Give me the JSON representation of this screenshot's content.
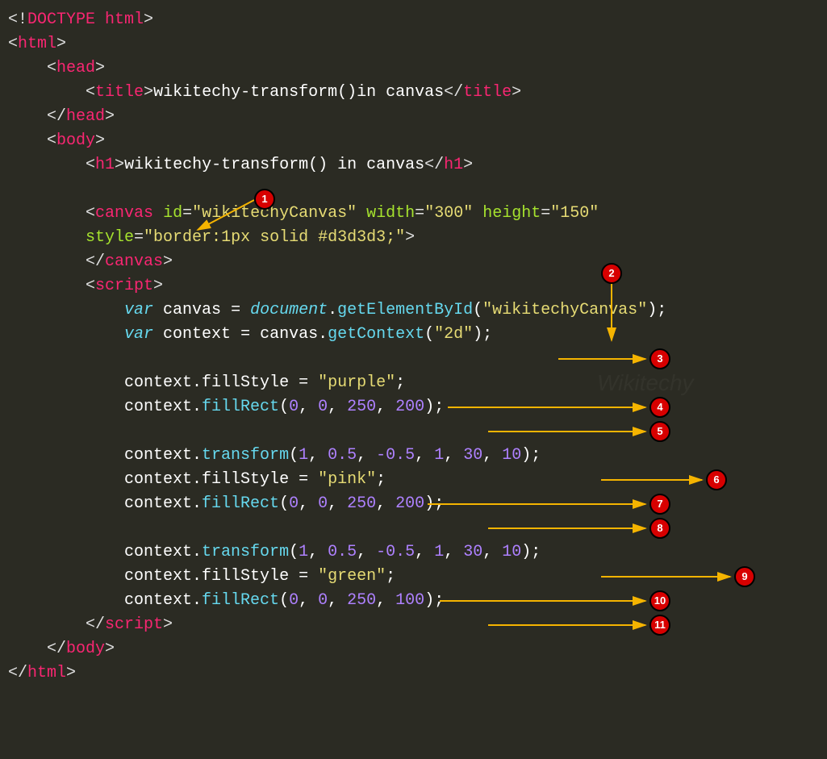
{
  "code": {
    "doctype": {
      "open": "<!",
      "name": "DOCTYPE html",
      "close": ">"
    },
    "html_open": "html",
    "head_open": "head",
    "title_tag": "title",
    "title_text": "wikitechy-transform()in canvas",
    "head_close": "head",
    "body_open": "body",
    "h1_tag": "h1",
    "h1_text": "wikitechy-transform() in canvas",
    "canvas_tag": "canvas",
    "canvas_attrs": {
      "id_name": "id",
      "id_val": "\"wikitechyCanvas\"",
      "width_name": "width",
      "width_val": "\"300\"",
      "height_name": "height",
      "height_val": "\"150\"",
      "style_name": "style",
      "style_val": "\"border:1px solid #d3d3d3;\""
    },
    "script_tag": "script",
    "lines": {
      "l1_var": "var",
      "l1_a": " canvas = ",
      "l1_doc": "document",
      "l1_b": ".",
      "l1_fn": "getElementById",
      "l1_c": "(",
      "l1_str": "\"wikitechyCanvas\"",
      "l1_d": ");",
      "l2_var": "var",
      "l2_a": " context = canvas.",
      "l2_fn": "getContext",
      "l2_c": "(",
      "l2_str": "\"2d\"",
      "l2_d": ");",
      "l3": "context.fillStyle = ",
      "l3_str": "\"purple\"",
      "l3_end": ";",
      "l4_a": "context.",
      "l4_fn": "fillRect",
      "l4_b": "(",
      "l4_n1": "0",
      "l4_c": ", ",
      "l4_n2": "0",
      "l4_d": ", ",
      "l4_n3": "250",
      "l4_e": ", ",
      "l4_n4": "200",
      "l4_f": ");",
      "l5_a": "context.",
      "l5_fn": "transform",
      "l5_b": "(",
      "l5_n1": "1",
      "l5_c": ", ",
      "l5_n2": "0.5",
      "l5_d": ", ",
      "l5_n3": "-0.5",
      "l5_e": ", ",
      "l5_n4": "1",
      "l5_f": ", ",
      "l5_n5": "30",
      "l5_g": ", ",
      "l5_n6": "10",
      "l5_h": ");",
      "l6": "context.fillStyle = ",
      "l6_str": "\"pink\"",
      "l6_end": ";",
      "l7_a": "context.",
      "l7_fn": "fillRect",
      "l7_b": "(",
      "l7_n1": "0",
      "l7_c": ", ",
      "l7_n2": "0",
      "l7_d": ", ",
      "l7_n3": "250",
      "l7_e": ", ",
      "l7_n4": "200",
      "l7_f": ");",
      "l8_a": "context.",
      "l8_fn": "transform",
      "l8_b": "(",
      "l8_n1": "1",
      "l8_c": ", ",
      "l8_n2": "0.5",
      "l8_d": ", ",
      "l8_n3": "-0.5",
      "l8_e": ", ",
      "l8_n4": "1",
      "l8_f": ", ",
      "l8_n5": "30",
      "l8_g": ", ",
      "l8_n6": "10",
      "l8_h": ");",
      "l9": "context.fillStyle = ",
      "l9_str": "\"green\"",
      "l9_end": ";",
      "l10_a": "context.",
      "l10_fn": "fillRect",
      "l10_b": "(",
      "l10_n1": "0",
      "l10_c": ", ",
      "l10_n2": "0",
      "l10_d": ", ",
      "l10_n3": "250",
      "l10_e": ", ",
      "l10_n4": "100",
      "l10_f": ");"
    }
  },
  "markers": {
    "m1": "1",
    "m2": "2",
    "m3": "3",
    "m4": "4",
    "m5": "5",
    "m6": "6",
    "m7": "7",
    "m8": "8",
    "m9": "9",
    "m10": "10",
    "m11": "11"
  },
  "watermark": "Wikitechy"
}
